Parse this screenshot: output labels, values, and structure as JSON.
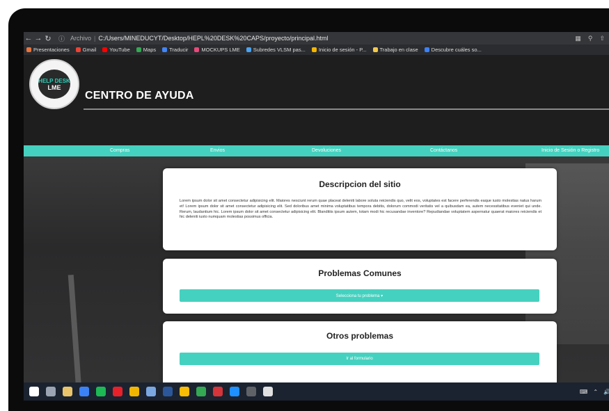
{
  "browser": {
    "url_prefix": "Archivo",
    "url": "C:/Users/MINEDUCYT/Desktop/HEPL%20DESK%20CAPS/proyecto/principal.html",
    "bookmarks": [
      {
        "label": "Presentaciones",
        "color": "#e8733c"
      },
      {
        "label": "Gmail",
        "color": "#ea4335"
      },
      {
        "label": "YouTube",
        "color": "#ff0000"
      },
      {
        "label": "Maps",
        "color": "#34a853"
      },
      {
        "label": "Traducir",
        "color": "#4285f4"
      },
      {
        "label": "MOCKUPS LME",
        "color": "#e64a7b"
      },
      {
        "label": "Subredes VLSM pas...",
        "color": "#4aa3f0"
      },
      {
        "label": "Inicio de sesión - P...",
        "color": "#f2b600"
      },
      {
        "label": "Trabajo en clase",
        "color": "#f2c94c"
      },
      {
        "label": "Descubre cuáles so...",
        "color": "#3b82f6"
      }
    ]
  },
  "site": {
    "logo": {
      "line1": "HELP DESK",
      "line2": "LME"
    },
    "title": "CENTRO DE AYUDA",
    "menu": [
      "Compras",
      "Envios",
      "Devoluciones",
      "Contáctanos",
      "Inicio de Sesión o Registro"
    ],
    "cards": {
      "descripcion": {
        "title": "Descripcion del sitio",
        "text": "Lorem ipsum dolor sit amet consectetur adipisicing elit. Maiores nesciunt rerum quae placeat deleniti labore soluta reiciendis quo, velit eos, voluptates est facere perferendis eaque iusto molestias natus harum et! Lorem ipsum dolor sit amet consectetur adipisicing elit. Sed doloribus amet minima voluptatibus tempora debitis, dolorum commodi veritatis vel a quibusdam ea, autem necessitatibus eveniet qui unde. Rerum, laudantium hic. Lorem ipsum dolor sit amet consectetur adipisicing elit. Blanditiis ipsum autem, totam modi hic recusandae inventore? Repudiandae voluptatem aspernatur quaerat maiores reiciendis et hic deleniti iusto numquam molestias possimus officia."
      },
      "problemas": {
        "title": "Problemas Comunes",
        "button": "Selecciona tu problema ▾"
      },
      "otros": {
        "title": "Otros problemas",
        "button": "Ir al formulario"
      }
    }
  },
  "taskbar": {
    "icons": [
      {
        "name": "start-icon",
        "color": "#ffffff"
      },
      {
        "name": "task-view-icon",
        "color": "#9aa4b2"
      },
      {
        "name": "file-explorer-icon",
        "color": "#e9c46a"
      },
      {
        "name": "mail-icon",
        "color": "#3b82f6"
      },
      {
        "name": "spotify-icon",
        "color": "#1db954"
      },
      {
        "name": "opera-icon",
        "color": "#e8202a"
      },
      {
        "name": "app-icon",
        "color": "#f2b600"
      },
      {
        "name": "notes-icon",
        "color": "#7aa7e0"
      },
      {
        "name": "word-icon",
        "color": "#2b579a"
      },
      {
        "name": "chrome-icon",
        "color": "#fbbc05"
      },
      {
        "name": "chrome-alt-icon",
        "color": "#34a853"
      },
      {
        "name": "red-app-icon",
        "color": "#d4343a"
      },
      {
        "name": "vscode-icon",
        "color": "#1e90ff"
      },
      {
        "name": "chrome-active-icon",
        "color": "#5f6368"
      },
      {
        "name": "settings-icon",
        "color": "#e0e0e0"
      }
    ]
  }
}
